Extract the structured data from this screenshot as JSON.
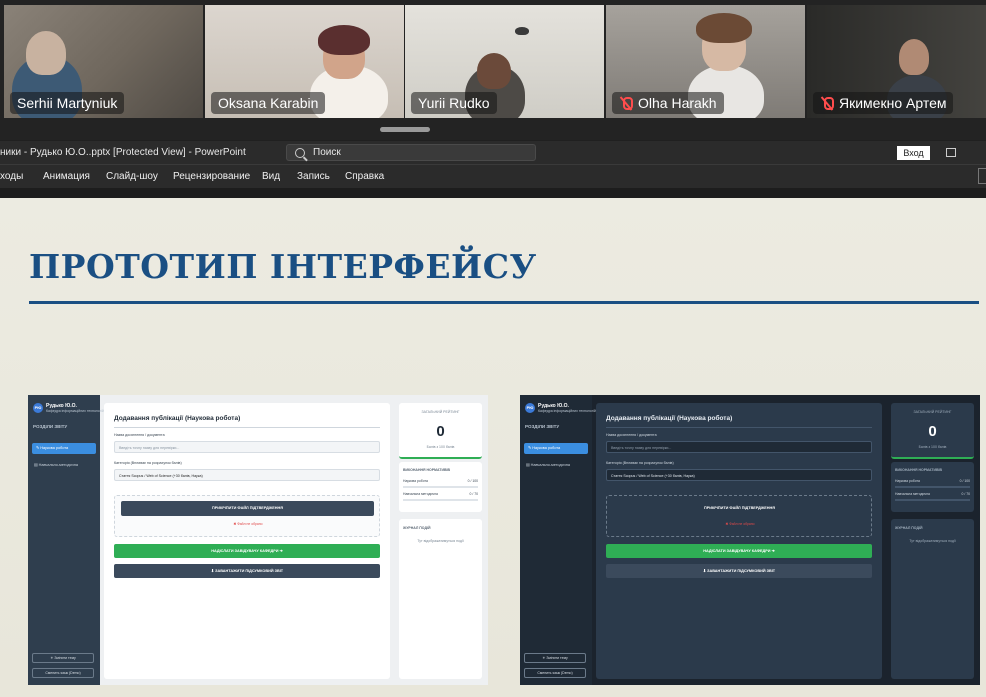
{
  "participants": [
    {
      "name": "Serhii Martyniuk",
      "muted": false,
      "active": false,
      "bg": "#7a7267"
    },
    {
      "name": "Oksana Karabin",
      "muted": false,
      "active": false,
      "bg": "#c9c3bb"
    },
    {
      "name": "Yurii Rudko",
      "muted": false,
      "active": true,
      "bg": "#d9d7d1"
    },
    {
      "name": "Olha Harakh",
      "muted": true,
      "active": false,
      "bg": "#8f8b86"
    },
    {
      "name": "Якимекно Артем",
      "muted": true,
      "active": false,
      "bg": "#3a3a38"
    }
  ],
  "ppt": {
    "doc_title": "ники - Рудько Ю.О..pptx [Protected View]  -  PowerPoint",
    "search_placeholder": "Поиск",
    "signin": "Вход",
    "ribbon_tabs": [
      "ходы",
      "Анимация",
      "Слайд-шоу",
      "Рецензирование",
      "Вид",
      "Запись",
      "Справка"
    ]
  },
  "slide": {
    "title": "ПРОТОТИП ІНТЕРФЕЙСУ"
  },
  "prototype": {
    "avatar": "РЮ",
    "user": "Рудько Ю.О.",
    "dept": "Кафедра інформаційних технологій",
    "section": "РОЗДІЛИ ЗВІТУ",
    "nav": [
      "Наукова робота",
      "Навчально-методична"
    ],
    "theme_btn": "Змінити тему",
    "lang_btn": "Сменить язык (Demo)",
    "heading": "Додавання публікації (Наукова робота)",
    "title_label": "Назва досягнення / документа",
    "title_placeholder": "Введіть точну назву для перевірки...",
    "category_label": "Категорія (Впливає на розрахунок балів)",
    "category_value": "Стаття Scopus / Web of Science (+30 балів, Наука)",
    "attach": "ПРИКРІПИТИ ФАЙЛ ПІДТВЕРДЖЕННЯ",
    "no_file": "Файл не обрано",
    "send": "НАДІСЛАТИ ЗАВІДУВАЧУ КАФЕДРИ ➜",
    "download": "ЗАВАНТАЖИТИ ПІДСУМКОВИЙ ЗВІТ",
    "rating_caption": "ЗАГАЛЬНИЙ РЕЙТИНГ",
    "rating_value": "0",
    "rating_sub": "Балів з 100 балів",
    "norms_title": "ВИКОНАННЯ НОРМАТИВІВ",
    "norms": [
      {
        "label": "Наукова робота",
        "value": "0 / 100"
      },
      {
        "label": "Навчальна методична",
        "value": "0 / 70"
      }
    ],
    "log_title": "ЖУРНАЛ ПОДІЙ",
    "log_empty": "Тут відображатимуться події"
  }
}
